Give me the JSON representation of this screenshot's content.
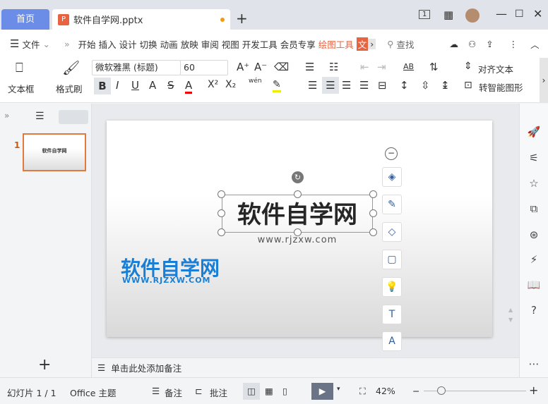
{
  "tabs": {
    "home": "首页",
    "doc": "软件自学网.pptx"
  },
  "window_icons": [
    "slide-count-icon",
    "grid-icon",
    "avatar",
    "minimize-icon",
    "maximize-icon",
    "close-icon"
  ],
  "window_badge": "1",
  "menu": {
    "file": "文件",
    "items": [
      "开始",
      "插入",
      "设计",
      "切换",
      "动画",
      "放映",
      "审阅",
      "视图",
      "开发工具",
      "会员专享"
    ],
    "active": "绘图工具",
    "cut": "文",
    "search": "查找"
  },
  "toolbar": {
    "textbox": "文本框",
    "format_painter": "格式刷",
    "font": "微软雅黑 (标题)",
    "size": "60",
    "align_text": "对齐文本",
    "smart_shape": "转智能图形",
    "phonetic": "wén"
  },
  "left": {
    "slide_number": "1",
    "thumb_title": "软件自学网"
  },
  "slide": {
    "title": "软件自学网",
    "subtitle": "www.rjzxw.com",
    "logo_cn": "软件自学网",
    "logo_en": "WWW.RJZXW.COM"
  },
  "notes": {
    "placeholder": "单击此处添加备注"
  },
  "status": {
    "slide": "幻灯片 1 / 1",
    "theme": "Office 主题",
    "notes": "备注",
    "comments": "批注",
    "zoom": "42%"
  },
  "colors": {
    "accent": "#6b8de8",
    "drawing_tab": "#e8633f",
    "logo_blue": "#1a7fd4"
  }
}
